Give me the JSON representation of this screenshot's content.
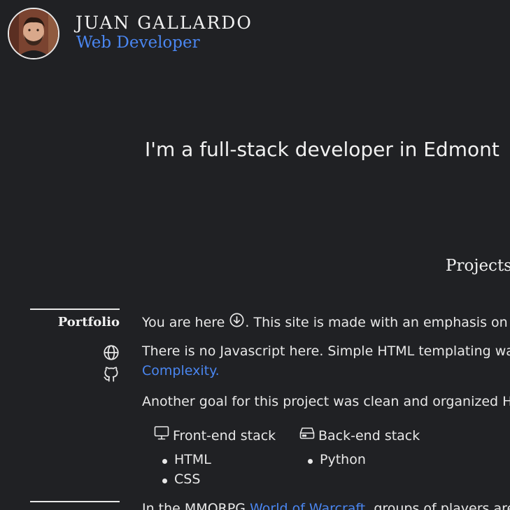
{
  "header": {
    "name": "JUAN GALLARDO",
    "role": "Web Developer",
    "avatar_icon": "profile-photo"
  },
  "hero": {
    "tagline": "I'm a full-stack developer in Edmont"
  },
  "projects": {
    "title": "Projects",
    "items": [
      {
        "name": "Portfolio",
        "links": [
          {
            "icon": "globe-icon"
          },
          {
            "icon": "github-icon"
          }
        ],
        "p1_a": "You are here",
        "p1_b": ". This site is made with an emphasis on t",
        "p2": "There is no Javascript here. Simple HTML templating was",
        "p2_link": "Complexity.",
        "p3": "Another goal for this project was clean and organized HT",
        "front_stack": {
          "label": "Front-end stack",
          "icon": "monitor-icon",
          "items": [
            "HTML",
            "CSS"
          ]
        },
        "back_stack": {
          "label": "Back-end stack",
          "icon": "server-icon",
          "items": [
            "Python"
          ]
        }
      },
      {
        "p_a": "In the MMORPG ",
        "p_link": "World of Warcraft",
        "p_b": ", groups of players are"
      }
    ]
  },
  "colors": {
    "background": "#202124",
    "text": "#e8e8e8",
    "accent": "#4a86f0"
  }
}
